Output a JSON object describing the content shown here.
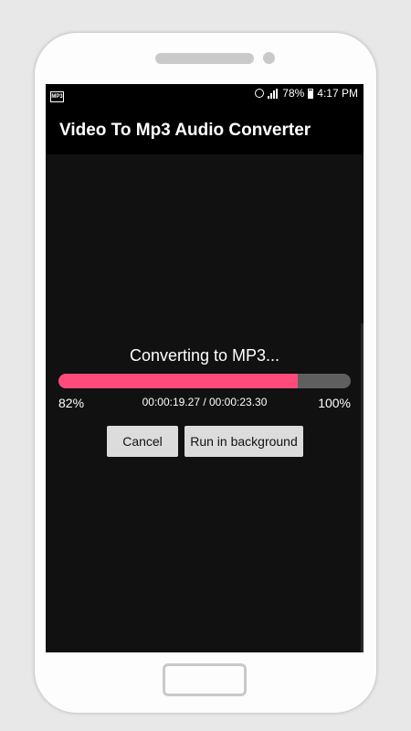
{
  "status_bar": {
    "left_icon": "mp3-notification-icon",
    "left_icon_text": "MP3",
    "battery": "78%",
    "time": "4:17 PM"
  },
  "app_bar": {
    "title": "Video To Mp3 Audio Converter"
  },
  "dialog": {
    "message": "Converting to MP3...",
    "progress_percent": 82,
    "progress_label": "82%",
    "time_progress": "00:00:19.27 / 00:00:23.30",
    "max_label": "100%",
    "cancel_label": "Cancel",
    "background_label": "Run in background"
  },
  "colors": {
    "progress_fill": "#ff4b7c",
    "progress_track": "#5f5f5f",
    "app_bar": "#000000"
  }
}
